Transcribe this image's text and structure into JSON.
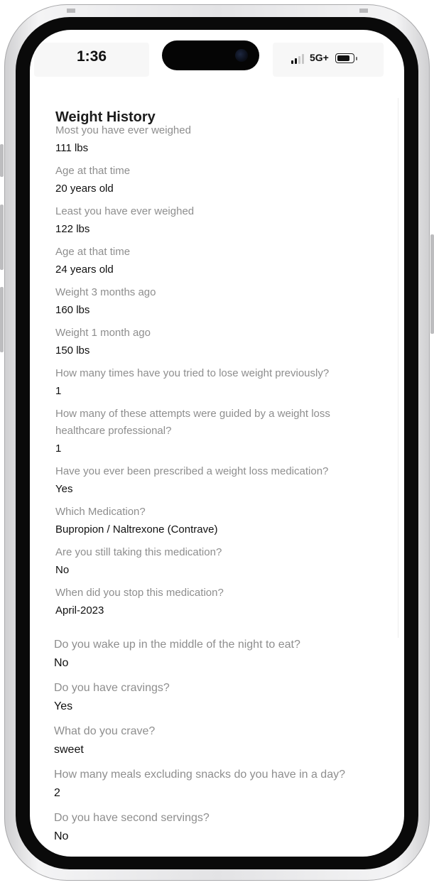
{
  "status_bar": {
    "time": "1:36",
    "network": "5G+",
    "signal_bars_active": 2,
    "signal_bars_total": 4
  },
  "page": {
    "title": "Weight History"
  },
  "weight_history": [
    {
      "question": "Most you have ever weighed",
      "answer": "111 lbs"
    },
    {
      "question": "Age at that time",
      "answer": "20 years old"
    },
    {
      "question": "Least you have ever weighed",
      "answer": "122 lbs"
    },
    {
      "question": "Age at that time",
      "answer": "24 years old"
    },
    {
      "question": "Weight 3 months ago",
      "answer": "160 lbs"
    },
    {
      "question": "Weight 1 month ago",
      "answer": "150 lbs"
    },
    {
      "question": "How many times have you tried to lose weight previously?",
      "answer": "1"
    },
    {
      "question_line1": "How many of these attempts were guided by a weight loss",
      "question_line2": "healthcare professional?",
      "answer": "1"
    },
    {
      "question": "Have you ever been prescribed a weight loss medication?",
      "answer": "Yes"
    },
    {
      "question": "Which Medication?",
      "answer": "Bupropion / Naltrexone (Contrave)"
    },
    {
      "question": "Are you still taking this medication?",
      "answer": "No"
    },
    {
      "question": "When did you stop this medication?",
      "answer": "April-2023"
    }
  ],
  "eating_habits": [
    {
      "question": "Do you wake up in the middle of the night to eat?",
      "answer": "No"
    },
    {
      "question": "Do you have cravings?",
      "answer": "Yes"
    },
    {
      "question": "What do you crave?",
      "answer": "sweet"
    },
    {
      "question": "How many meals excluding snacks do you have in a day?",
      "answer": "2"
    },
    {
      "question": "Do you have second servings?",
      "answer": "No"
    }
  ]
}
